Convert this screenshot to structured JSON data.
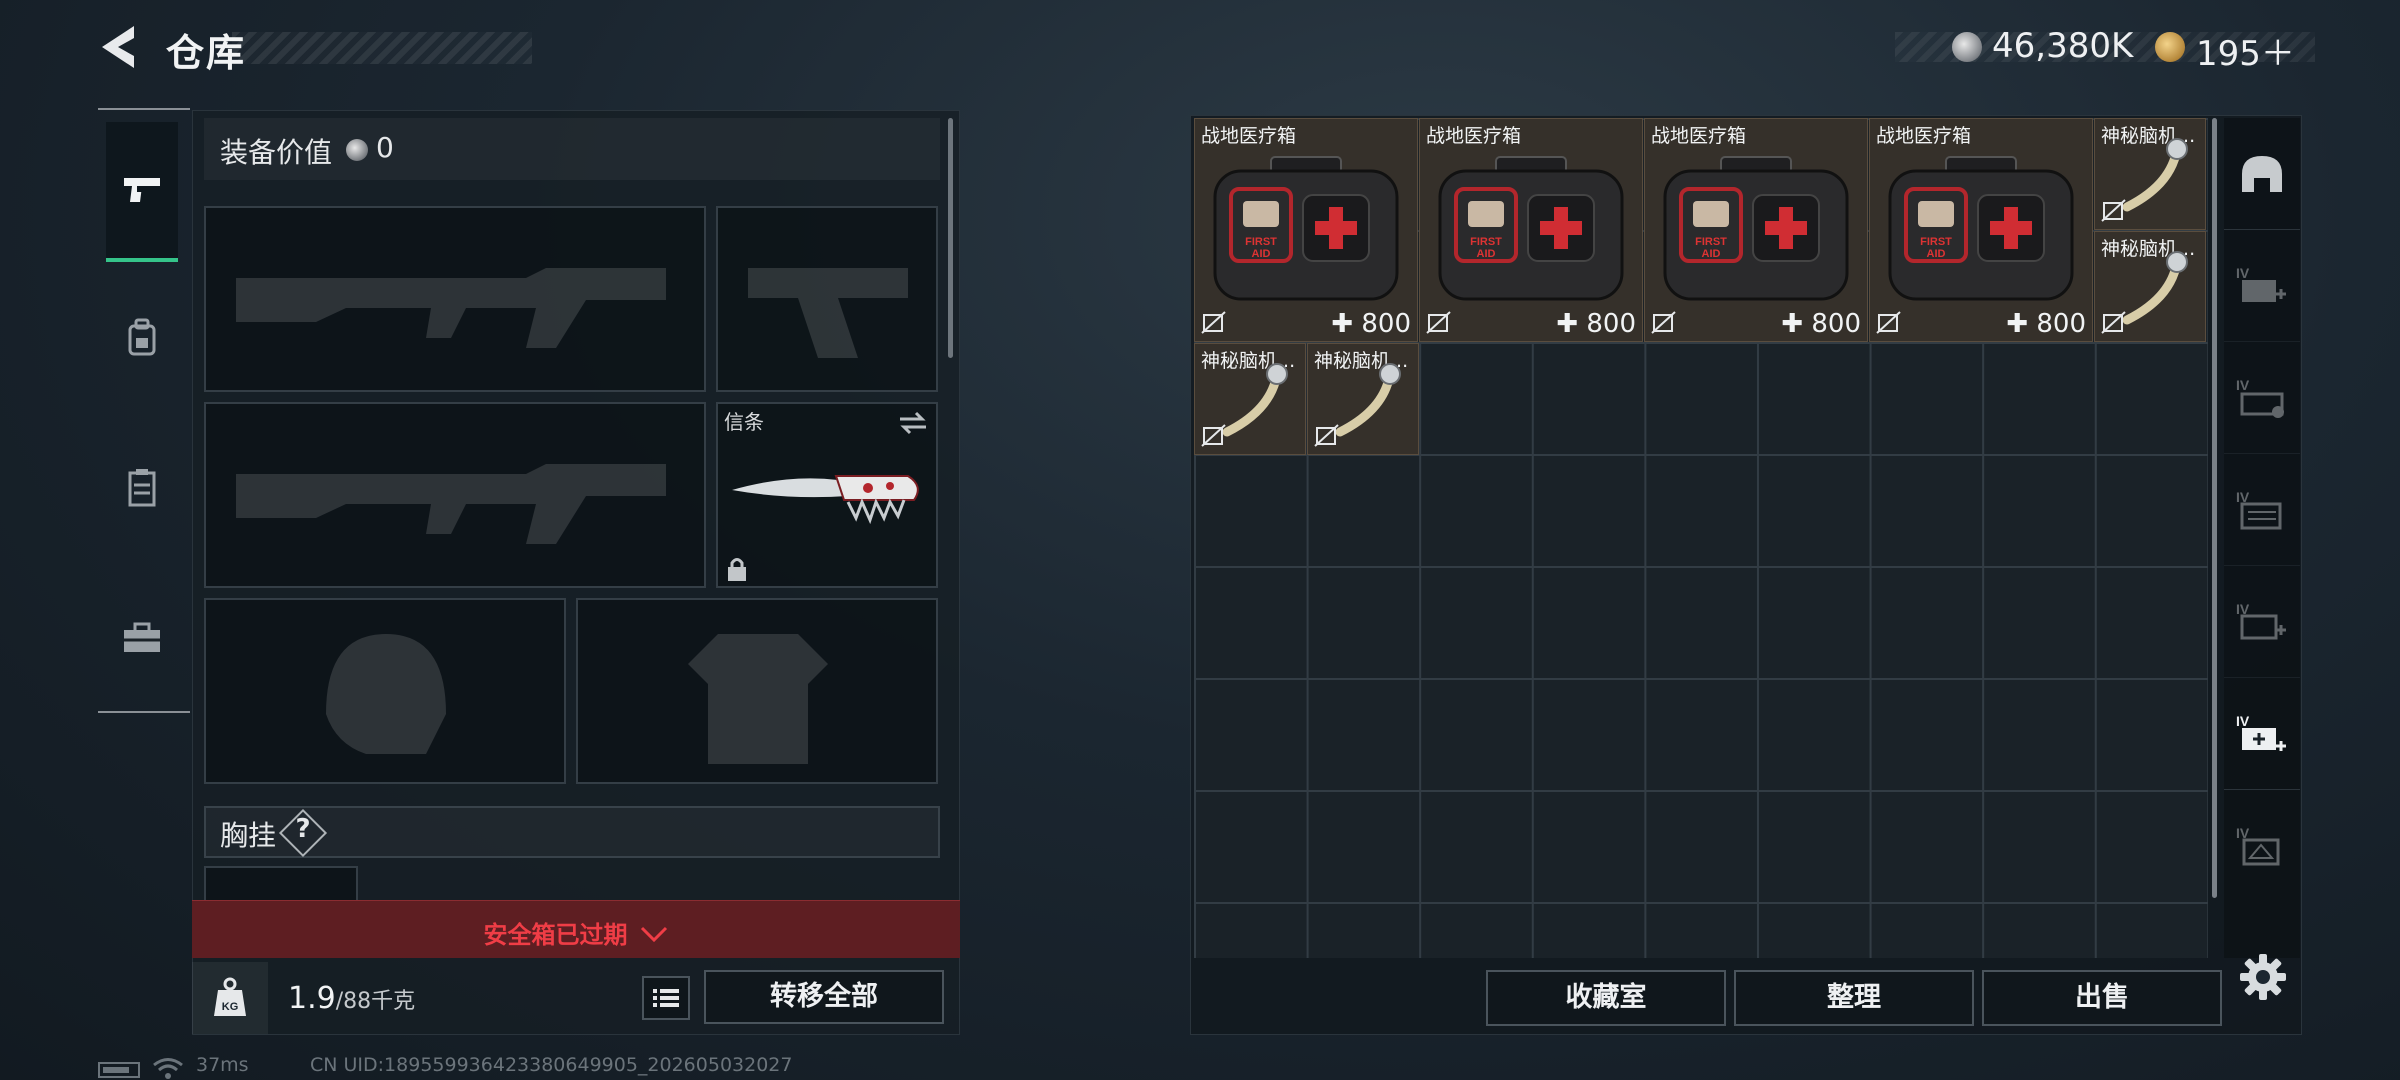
{
  "header": {
    "title": "仓库",
    "currency": {
      "silver": "46,380K",
      "gold": "195＋"
    }
  },
  "loadout": {
    "value_label": "装备价值",
    "value": "0",
    "secondary_slot_label": "信条",
    "chest_label": "胸挂",
    "chest_help": "?",
    "safebox_status": "安全箱已过期",
    "weight": "1.9",
    "weight_capacity": "/88千克",
    "transfer_all": "转移全部"
  },
  "storage": {
    "items": [
      {
        "name": "战地医疗箱",
        "price": "800"
      },
      {
        "name": "战地医疗箱",
        "price": "800"
      },
      {
        "name": "战地医疗箱",
        "price": "800"
      },
      {
        "name": "战地医疗箱",
        "price": "800"
      },
      {
        "name": "神秘脑机..."
      },
      {
        "name": "神秘脑机..."
      },
      {
        "name": "神秘脑机..."
      },
      {
        "name": "神秘脑机..."
      }
    ],
    "buttons": {
      "collection": "收藏室",
      "organize": "整理",
      "sell": "出售"
    }
  },
  "sidebar_icons": [
    "helmet-dome-icon",
    "medkit-plus-icon",
    "ammo-box-icon",
    "folder-stack-icon",
    "medkit-plus-icon",
    "medkit-plus-icon",
    "key-card-icon"
  ],
  "status_bar": {
    "ping": "37ms",
    "uid": "CN UID:18955993642338064990​5_202605032027"
  },
  "colors": {
    "accent_green": "#35c48a",
    "alert_red": "#f03d46",
    "item_bg": "#35302a"
  }
}
